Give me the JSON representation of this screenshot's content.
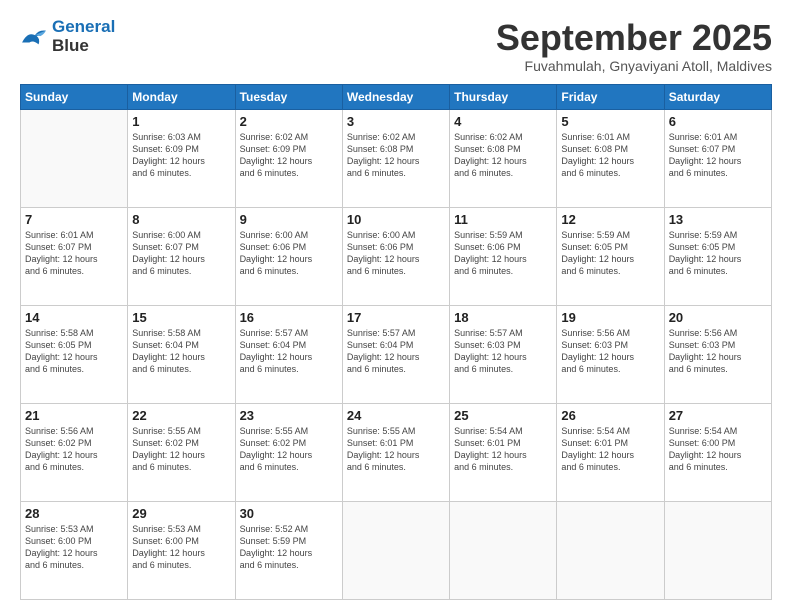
{
  "logo": {
    "line1": "General",
    "line2": "Blue"
  },
  "header": {
    "month": "September 2025",
    "location": "Fuvahmulah, Gnyaviyani Atoll, Maldives"
  },
  "days_of_week": [
    "Sunday",
    "Monday",
    "Tuesday",
    "Wednesday",
    "Thursday",
    "Friday",
    "Saturday"
  ],
  "weeks": [
    [
      {
        "day": "",
        "info": ""
      },
      {
        "day": "1",
        "info": "Sunrise: 6:03 AM\nSunset: 6:09 PM\nDaylight: 12 hours\nand 6 minutes."
      },
      {
        "day": "2",
        "info": "Sunrise: 6:02 AM\nSunset: 6:09 PM\nDaylight: 12 hours\nand 6 minutes."
      },
      {
        "day": "3",
        "info": "Sunrise: 6:02 AM\nSunset: 6:08 PM\nDaylight: 12 hours\nand 6 minutes."
      },
      {
        "day": "4",
        "info": "Sunrise: 6:02 AM\nSunset: 6:08 PM\nDaylight: 12 hours\nand 6 minutes."
      },
      {
        "day": "5",
        "info": "Sunrise: 6:01 AM\nSunset: 6:08 PM\nDaylight: 12 hours\nand 6 minutes."
      },
      {
        "day": "6",
        "info": "Sunrise: 6:01 AM\nSunset: 6:07 PM\nDaylight: 12 hours\nand 6 minutes."
      }
    ],
    [
      {
        "day": "7",
        "info": "Sunrise: 6:01 AM\nSunset: 6:07 PM\nDaylight: 12 hours\nand 6 minutes."
      },
      {
        "day": "8",
        "info": "Sunrise: 6:00 AM\nSunset: 6:07 PM\nDaylight: 12 hours\nand 6 minutes."
      },
      {
        "day": "9",
        "info": "Sunrise: 6:00 AM\nSunset: 6:06 PM\nDaylight: 12 hours\nand 6 minutes."
      },
      {
        "day": "10",
        "info": "Sunrise: 6:00 AM\nSunset: 6:06 PM\nDaylight: 12 hours\nand 6 minutes."
      },
      {
        "day": "11",
        "info": "Sunrise: 5:59 AM\nSunset: 6:06 PM\nDaylight: 12 hours\nand 6 minutes."
      },
      {
        "day": "12",
        "info": "Sunrise: 5:59 AM\nSunset: 6:05 PM\nDaylight: 12 hours\nand 6 minutes."
      },
      {
        "day": "13",
        "info": "Sunrise: 5:59 AM\nSunset: 6:05 PM\nDaylight: 12 hours\nand 6 minutes."
      }
    ],
    [
      {
        "day": "14",
        "info": "Sunrise: 5:58 AM\nSunset: 6:05 PM\nDaylight: 12 hours\nand 6 minutes."
      },
      {
        "day": "15",
        "info": "Sunrise: 5:58 AM\nSunset: 6:04 PM\nDaylight: 12 hours\nand 6 minutes."
      },
      {
        "day": "16",
        "info": "Sunrise: 5:57 AM\nSunset: 6:04 PM\nDaylight: 12 hours\nand 6 minutes."
      },
      {
        "day": "17",
        "info": "Sunrise: 5:57 AM\nSunset: 6:04 PM\nDaylight: 12 hours\nand 6 minutes."
      },
      {
        "day": "18",
        "info": "Sunrise: 5:57 AM\nSunset: 6:03 PM\nDaylight: 12 hours\nand 6 minutes."
      },
      {
        "day": "19",
        "info": "Sunrise: 5:56 AM\nSunset: 6:03 PM\nDaylight: 12 hours\nand 6 minutes."
      },
      {
        "day": "20",
        "info": "Sunrise: 5:56 AM\nSunset: 6:03 PM\nDaylight: 12 hours\nand 6 minutes."
      }
    ],
    [
      {
        "day": "21",
        "info": "Sunrise: 5:56 AM\nSunset: 6:02 PM\nDaylight: 12 hours\nand 6 minutes."
      },
      {
        "day": "22",
        "info": "Sunrise: 5:55 AM\nSunset: 6:02 PM\nDaylight: 12 hours\nand 6 minutes."
      },
      {
        "day": "23",
        "info": "Sunrise: 5:55 AM\nSunset: 6:02 PM\nDaylight: 12 hours\nand 6 minutes."
      },
      {
        "day": "24",
        "info": "Sunrise: 5:55 AM\nSunset: 6:01 PM\nDaylight: 12 hours\nand 6 minutes."
      },
      {
        "day": "25",
        "info": "Sunrise: 5:54 AM\nSunset: 6:01 PM\nDaylight: 12 hours\nand 6 minutes."
      },
      {
        "day": "26",
        "info": "Sunrise: 5:54 AM\nSunset: 6:01 PM\nDaylight: 12 hours\nand 6 minutes."
      },
      {
        "day": "27",
        "info": "Sunrise: 5:54 AM\nSunset: 6:00 PM\nDaylight: 12 hours\nand 6 minutes."
      }
    ],
    [
      {
        "day": "28",
        "info": "Sunrise: 5:53 AM\nSunset: 6:00 PM\nDaylight: 12 hours\nand 6 minutes."
      },
      {
        "day": "29",
        "info": "Sunrise: 5:53 AM\nSunset: 6:00 PM\nDaylight: 12 hours\nand 6 minutes."
      },
      {
        "day": "30",
        "info": "Sunrise: 5:52 AM\nSunset: 5:59 PM\nDaylight: 12 hours\nand 6 minutes."
      },
      {
        "day": "",
        "info": ""
      },
      {
        "day": "",
        "info": ""
      },
      {
        "day": "",
        "info": ""
      },
      {
        "day": "",
        "info": ""
      }
    ]
  ]
}
